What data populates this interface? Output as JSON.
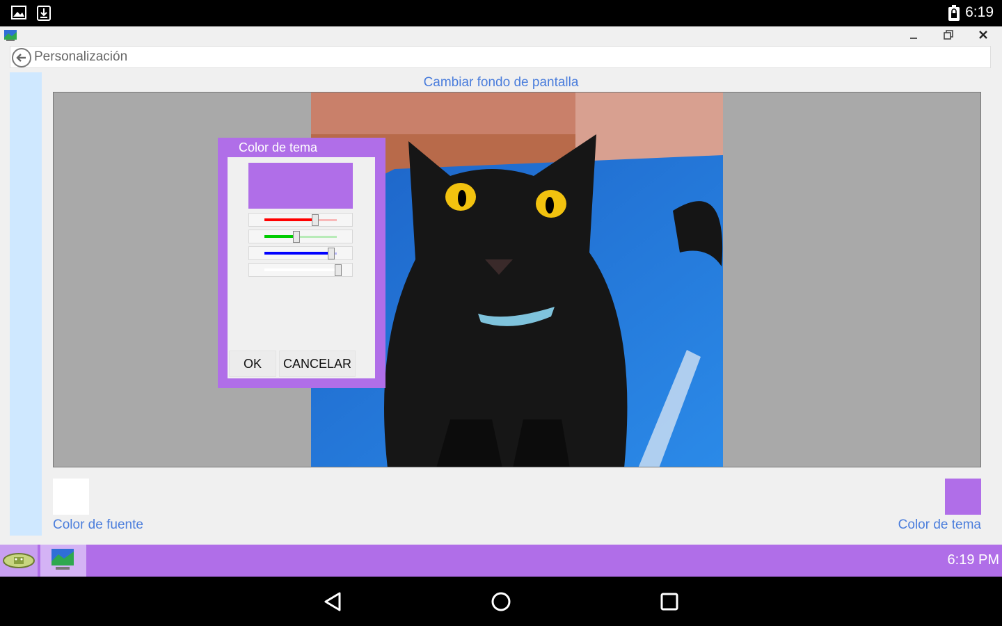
{
  "status_bar": {
    "time": "6:19",
    "icons": [
      "image-icon",
      "download-icon",
      "battery-icon"
    ]
  },
  "window": {
    "controls": [
      "minimize-icon",
      "restore-icon",
      "close-icon"
    ],
    "address": {
      "title": "Personalización"
    },
    "content": {
      "section_title": "Cambiar fondo de pantalla",
      "font_color_label": "Color de fuente",
      "theme_color_label": "Color de tema",
      "font_color": "#ffffff",
      "theme_color": "#b06ee8"
    }
  },
  "dialog": {
    "title": "Color de tema",
    "preview_color": "#b06ee8",
    "sliders": [
      {
        "name": "red",
        "color": "#ff0000",
        "value": 176,
        "max": 255
      },
      {
        "name": "green",
        "color": "#00cc00",
        "value": 110,
        "max": 255
      },
      {
        "name": "blue",
        "color": "#0000ff",
        "value": 232,
        "max": 255
      },
      {
        "name": "alpha",
        "color": "#ffffff",
        "value": 255,
        "max": 255
      }
    ],
    "ok_label": "OK",
    "cancel_label": "CANCELAR"
  },
  "taskbar": {
    "color": "#b06ee8",
    "time": "6:19 PM"
  },
  "nav_bar": [
    "back-icon",
    "home-icon",
    "recents-icon"
  ]
}
